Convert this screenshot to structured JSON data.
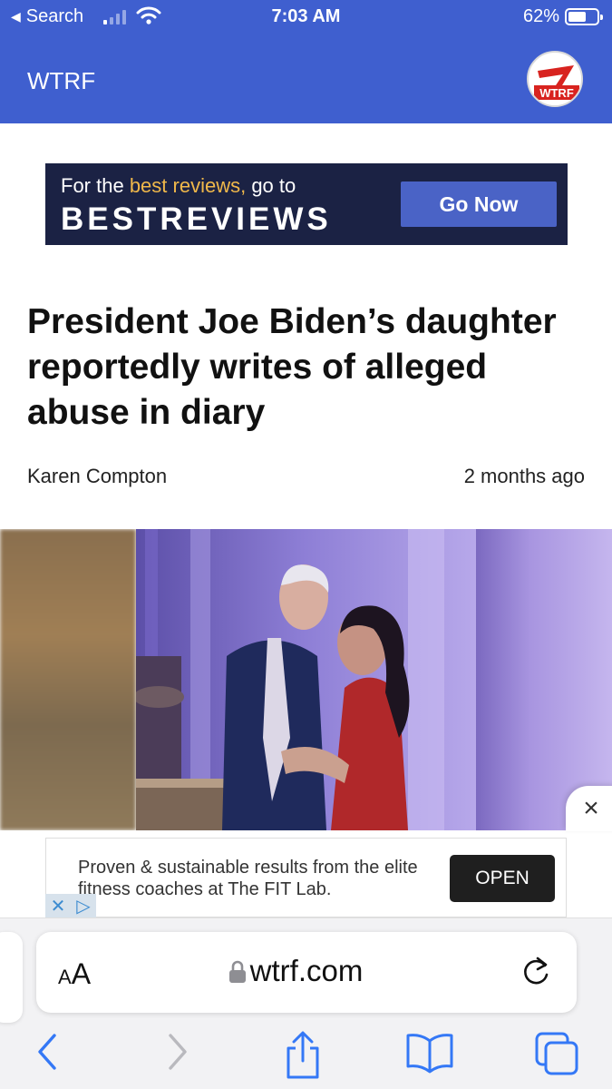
{
  "status_bar": {
    "back_label": "Search",
    "time": "7:03 AM",
    "battery_percent": "62%",
    "battery_level": 0.62,
    "signal_bars_filled": 1
  },
  "site": {
    "title": "WTRF",
    "logo_text": "WTRF",
    "logo_number": "7"
  },
  "top_ad": {
    "line1_prefix": "For the ",
    "line1_highlight": "best reviews,",
    "line1_suffix": " go to",
    "brand": "BESTREVIEWS",
    "button_label": "Go Now"
  },
  "article": {
    "headline": "President Joe Biden’s daughter reportedly writes of alleged abuse in diary",
    "author": "Karen Compton",
    "time_ago": "2 months ago"
  },
  "bottom_ad": {
    "text": "Proven & sustainable results from the elite fitness coaches at The FIT Lab.",
    "button_label": "OPEN",
    "close_icon": "×",
    "adchoices_x": "✕",
    "adchoices_play": "▷"
  },
  "browser": {
    "text_size_label_small": "A",
    "text_size_label_large": "A",
    "url": "wtrf.com"
  },
  "colors": {
    "header_blue": "#3f5fcf",
    "ad_navy": "#1b2244",
    "ad_gold": "#f0b84a",
    "safari_blue": "#3478f6"
  }
}
